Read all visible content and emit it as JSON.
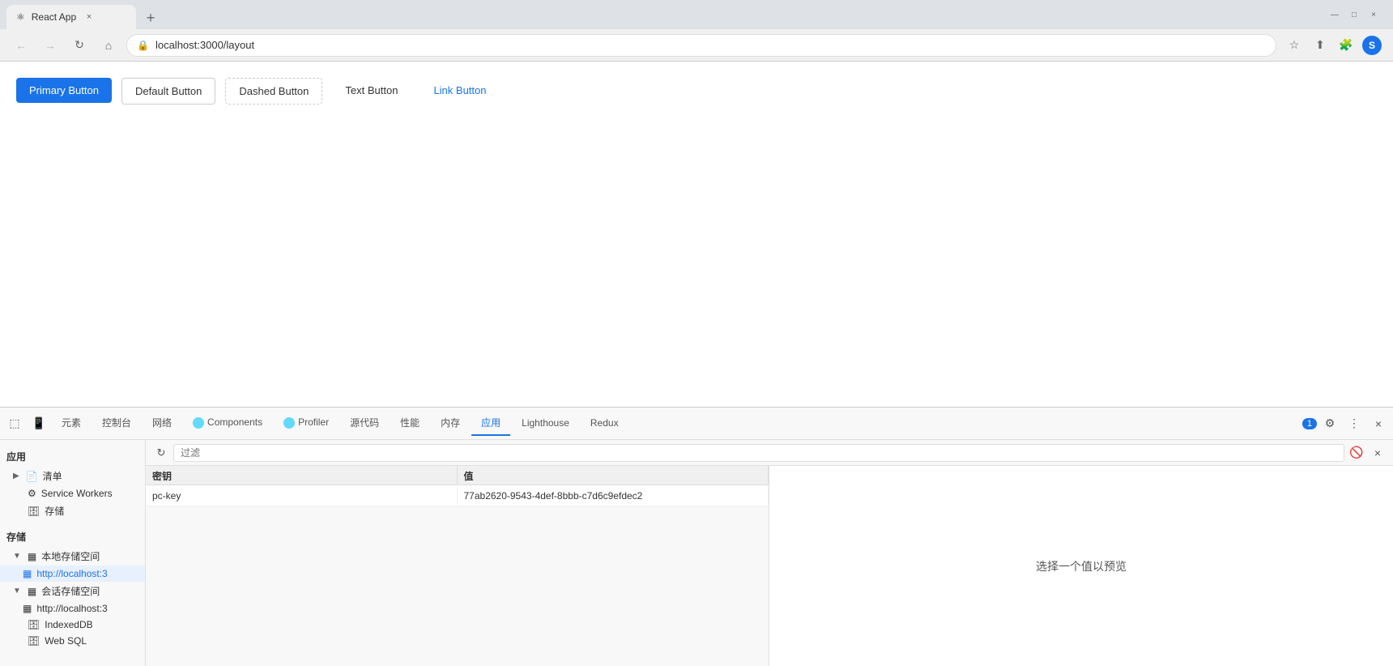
{
  "browser": {
    "tab": {
      "title": "React App",
      "favicon": "⚛"
    },
    "url": "localhost:3000/layout",
    "window_controls": {
      "minimize": "−",
      "maximize": "□",
      "close": "×"
    }
  },
  "page": {
    "buttons": {
      "primary": "Primary Button",
      "default": "Default Button",
      "dashed": "Dashed Button",
      "text": "Text Button",
      "link": "Link Button"
    }
  },
  "devtools": {
    "tabs": [
      {
        "id": "elements",
        "label": "元素"
      },
      {
        "id": "console",
        "label": "控制台"
      },
      {
        "id": "network",
        "label": "网络"
      },
      {
        "id": "components",
        "label": "Components"
      },
      {
        "id": "profiler",
        "label": "Profiler"
      },
      {
        "id": "source",
        "label": "源代码"
      },
      {
        "id": "performance",
        "label": "性能"
      },
      {
        "id": "memory",
        "label": "内存"
      },
      {
        "id": "application",
        "label": "应用",
        "active": true
      },
      {
        "id": "lighthouse",
        "label": "Lighthouse"
      },
      {
        "id": "redux",
        "label": "Redux"
      }
    ],
    "badge": "1",
    "sidebar": {
      "sections": [
        {
          "title": "应用",
          "items": [
            {
              "id": "qingdan",
              "label": "清单",
              "icon": "📄",
              "expand": "▶"
            },
            {
              "id": "service-workers",
              "label": "Service Workers",
              "icon": "⚙"
            },
            {
              "id": "storage",
              "label": "存储",
              "icon": "🗄"
            }
          ]
        },
        {
          "title": "存储",
          "items": [
            {
              "id": "local-storage",
              "label": "本地存储空间",
              "icon": "▦",
              "expand": "▼",
              "expanded": true
            },
            {
              "id": "local-storage-localhost",
              "label": "http://localhost:3",
              "icon": "▦",
              "indented": true,
              "active": true
            },
            {
              "id": "session-storage",
              "label": "会话存储空间",
              "icon": "▦",
              "expand": "▼",
              "expanded": true
            },
            {
              "id": "session-storage-localhost",
              "label": "http://localhost:3",
              "icon": "▦",
              "indented": true
            },
            {
              "id": "indexeddb",
              "label": "IndexedDB",
              "icon": "🗄"
            },
            {
              "id": "web-sql",
              "label": "Web SQL",
              "icon": "🗄"
            }
          ]
        }
      ]
    },
    "panel": {
      "filter_placeholder": "过滤",
      "table": {
        "headers": [
          "密钥",
          "值"
        ],
        "rows": [
          {
            "key": "pc-key",
            "value": "77ab2620-9543-4def-8bbb-c7d6c9efdec2"
          }
        ]
      },
      "preview_text": "选择一个值以预览"
    }
  }
}
